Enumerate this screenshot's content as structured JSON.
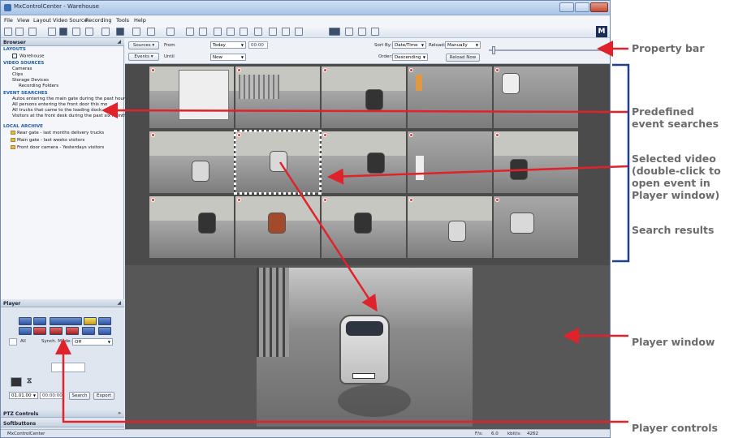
{
  "window": {
    "title": "MxControlCenter - Warehouse",
    "status_left": "MxControlCenter",
    "status_fps_label": "F/s:",
    "status_fps": "6.0",
    "status_kbit_label": "kbit/s:",
    "status_kbit": "4262"
  },
  "menu": [
    "File",
    "View",
    "Layout",
    "Video Source",
    "Recording",
    "Tools",
    "Help"
  ],
  "browser": {
    "title": "Browser",
    "layouts_header": "LAYOUTS",
    "layouts": [
      "Warehouse"
    ],
    "video_sources_header": "VIDEO SOURCES",
    "video_sources": [
      "Cameras",
      "Clips",
      "Storage Devices",
      "Recording Folders"
    ],
    "event_searches_header": "EVENT SEARCHES",
    "event_searches": [
      "Autos entering the main gate during the past hour",
      "All persons entering the front door this mo",
      "All trucks that came to the loading dock",
      "Visitors at the front desk during the past six months"
    ],
    "local_archive_header": "LOCAL ARCHIVE",
    "local_archive": [
      "Rear gate - last months delivery trucks",
      "Main gate - last weeks visitors",
      "Front door camera - Yesterdays visitors"
    ]
  },
  "player_panel": {
    "title": "Player",
    "all_label": "All",
    "synch_label": "Synch. Mode:",
    "synch_value": "Off",
    "date_value": "01.01.00",
    "time_value": "00:00:00",
    "search_label": "Search",
    "export_label": "Export"
  },
  "ptz_title": "PTZ Controls",
  "softbuttons_title": "Softbuttons",
  "property_bar": {
    "sources_label": "Sources",
    "events_label": "Events",
    "from_label": "From",
    "until_label": "Until",
    "from_value": "Today",
    "from_time": "00:00",
    "until_value": "Now",
    "sort_by_label": "Sort By:",
    "sort_by_value": "Date/Time",
    "reload_label": "Reload:",
    "reload_value": "Manually",
    "order_label": "Order:",
    "order_value": "Descending",
    "reload_now_label": "Reload Now"
  },
  "callouts": {
    "property_bar": "Property bar",
    "predefined": "Predefined\nevent searches",
    "selected": "Selected video\n(double-click to\nopen event in\nPlayer window)",
    "search_results": "Search results",
    "player_window": "Player window",
    "player_controls": "Player controls"
  },
  "colors": {
    "arrow": "#e0222a",
    "bracket": "#1f3f8f",
    "callout_text": "#6b6b6b"
  }
}
